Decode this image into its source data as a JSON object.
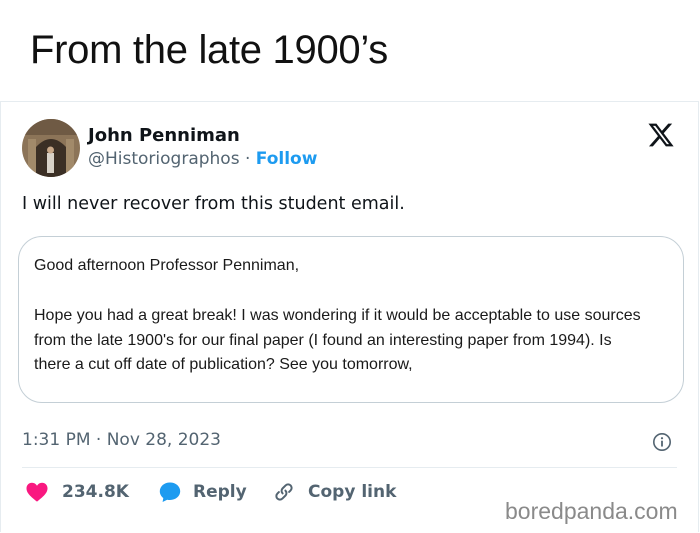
{
  "header": {
    "title": "From the late 1900’s"
  },
  "tweet": {
    "author_name": "John Penniman",
    "handle": "@Historiographos",
    "separator": "·",
    "follow_label": "Follow",
    "text": "I will never recover from this student email.",
    "timestamp": "1:31 PM · Nov 28, 2023"
  },
  "email": {
    "lines": [
      "Good afternoon Professor Penniman,",
      "Hope you had a great break! I was wondering if it would be acceptable to use sources",
      "from the late 1900's for our final paper (I found an interesting paper from 1994). Is",
      "there a cut off date of publication? See you tomorrow,"
    ]
  },
  "actions": {
    "like_count": "234.8K",
    "reply_label": "Reply",
    "copy_link_label": "Copy link"
  },
  "watermark": "boredpanda.com",
  "colors": {
    "accent_blue": "#1d9bf0",
    "like_red": "#f91880",
    "text_primary": "#0f1419",
    "text_secondary": "#536471"
  },
  "icons": [
    "x-logo-icon",
    "info-icon",
    "heart-icon",
    "reply-bubble-icon",
    "link-icon"
  ]
}
